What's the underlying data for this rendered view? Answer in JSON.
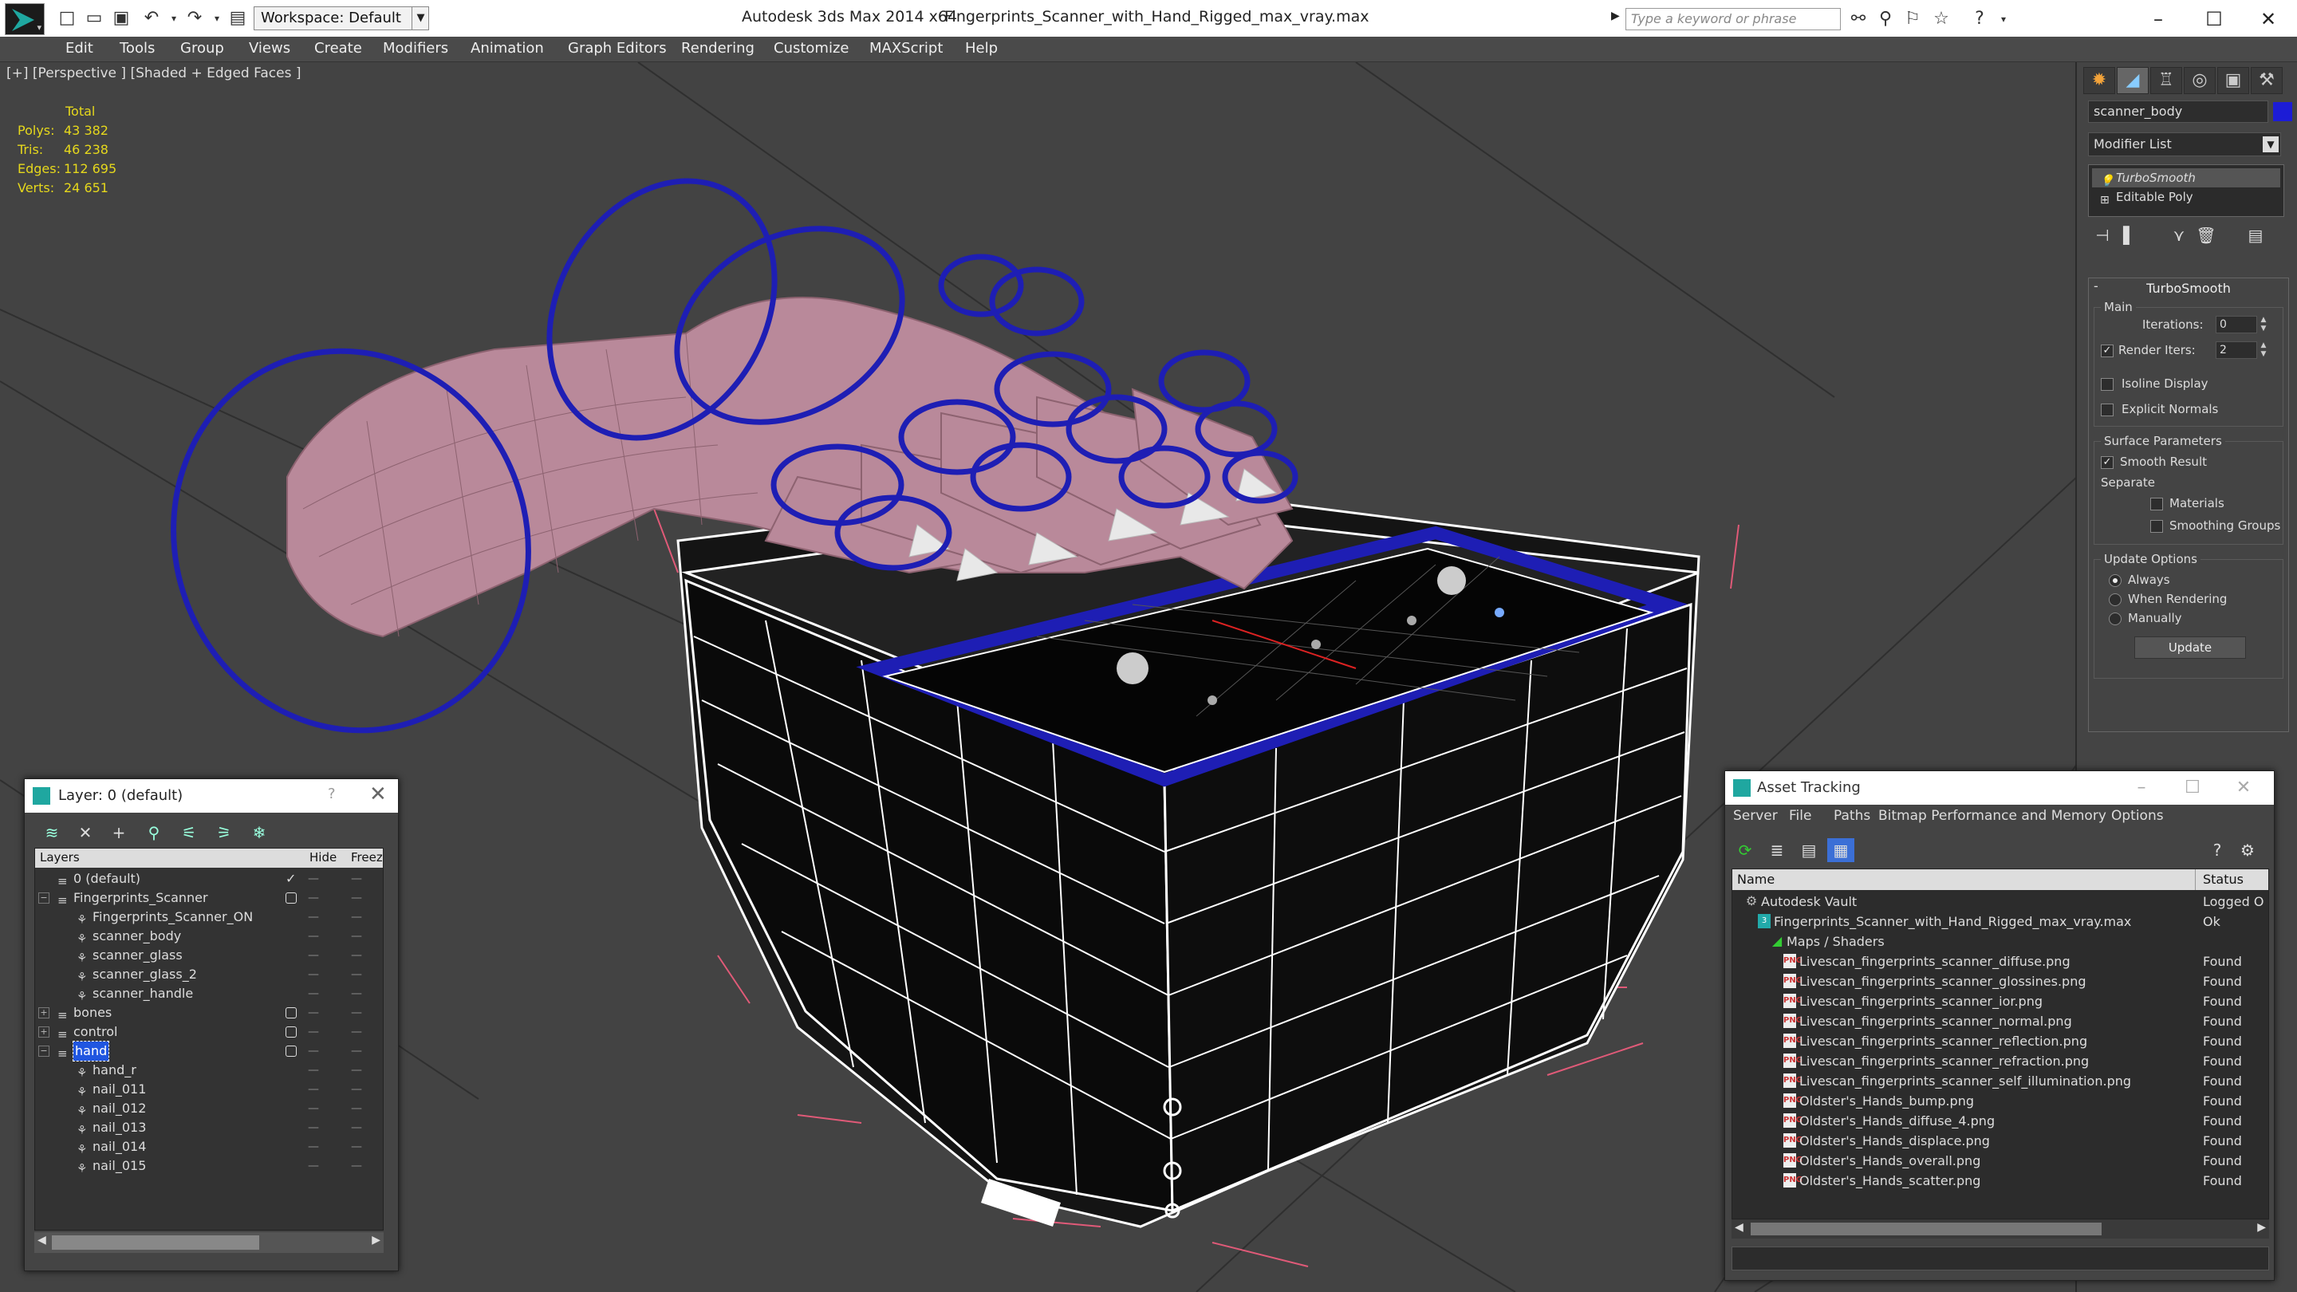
{
  "titlebar": {
    "workspace": "Workspace: Default",
    "app_title": "Autodesk 3ds Max  2014 x64",
    "file_title": "Fingerprints_Scanner_with_Hand_Rigged_max_vray.max",
    "search_placeholder": "Type a keyword or phrase"
  },
  "menus": [
    "Edit",
    "Tools",
    "Group",
    "Views",
    "Create",
    "Modifiers",
    "Animation",
    "Graph Editors",
    "Rendering",
    "Customize",
    "MAXScript",
    "Help"
  ],
  "viewport": {
    "label": "[+] [Perspective ] [Shaded + Edged Faces ]",
    "stats": {
      "header": "Total",
      "rows": [
        {
          "k": "Polys:",
          "v": "43 382"
        },
        {
          "k": "Tris:",
          "v": "46 238"
        },
        {
          "k": "Edges:",
          "v": "112 695"
        },
        {
          "k": "Verts:",
          "v": "24 651"
        }
      ]
    }
  },
  "command_panel": {
    "object_name": "scanner_body",
    "object_color": "#1c1cd6",
    "modifier_list": "Modifier List",
    "stack": [
      "TurboSmooth",
      "Editable Poly"
    ],
    "rollout_title": "TurboSmooth",
    "main_label": "Main",
    "iterations_label": "Iterations:",
    "iterations_value": "0",
    "render_iters_label": "Render Iters:",
    "render_iters_value": "2",
    "isoline": "Isoline Display",
    "explicit": "Explicit Normals",
    "surface_params": "Surface Parameters",
    "smooth_result": "Smooth Result",
    "separate": "Separate",
    "materials": "Materials",
    "smoothing_groups": "Smoothing Groups",
    "update_options": "Update Options",
    "always": "Always",
    "when_rendering": "When Rendering",
    "manually": "Manually",
    "update_button": "Update"
  },
  "layer_dialog": {
    "title": "Layer: 0 (default)",
    "help": "?",
    "col_layers": "Layers",
    "col_hide": "Hide",
    "col_freeze": "Freeze",
    "rows": [
      {
        "name": "0 (default)",
        "indent": 0,
        "type": "layer",
        "state": "current"
      },
      {
        "name": "Fingerprints_Scanner",
        "indent": 0,
        "type": "layer",
        "exp": "−",
        "state": "box"
      },
      {
        "name": "Fingerprints_Scanner_ON",
        "indent": 1,
        "type": "obj"
      },
      {
        "name": "scanner_body",
        "indent": 1,
        "type": "obj"
      },
      {
        "name": "scanner_glass",
        "indent": 1,
        "type": "obj"
      },
      {
        "name": "scanner_glass_2",
        "indent": 1,
        "type": "obj"
      },
      {
        "name": "scanner_handle",
        "indent": 1,
        "type": "obj"
      },
      {
        "name": "bones",
        "indent": 0,
        "type": "layer",
        "exp": "+",
        "state": "box"
      },
      {
        "name": "control",
        "indent": 0,
        "type": "layer",
        "exp": "+",
        "state": "box"
      },
      {
        "name": "hand",
        "indent": 0,
        "type": "layer",
        "exp": "−",
        "state": "box",
        "selected": true
      },
      {
        "name": "hand_r",
        "indent": 1,
        "type": "obj"
      },
      {
        "name": "nail_011",
        "indent": 1,
        "type": "obj"
      },
      {
        "name": "nail_012",
        "indent": 1,
        "type": "obj"
      },
      {
        "name": "nail_013",
        "indent": 1,
        "type": "obj"
      },
      {
        "name": "nail_014",
        "indent": 1,
        "type": "obj"
      },
      {
        "name": "nail_015",
        "indent": 1,
        "type": "obj"
      }
    ]
  },
  "asset_dialog": {
    "title": "Asset Tracking",
    "menus": [
      "Server",
      "File",
      "Paths",
      "Bitmap Performance and Memory",
      "Options"
    ],
    "col_name": "Name",
    "col_status": "Status",
    "rows": [
      {
        "name": "Autodesk Vault",
        "indent": 0,
        "icon": "vault",
        "status": "Logged O"
      },
      {
        "name": "Fingerprints_Scanner_with_Hand_Rigged_max_vray.max",
        "indent": 1,
        "icon": "max",
        "status": "Ok"
      },
      {
        "name": "Maps / Shaders",
        "indent": 2,
        "icon": "fold",
        "status": ""
      },
      {
        "name": "Livescan_fingerprints_scanner_diffuse.png",
        "indent": 3,
        "icon": "png",
        "status": "Found"
      },
      {
        "name": "Livescan_fingerprints_scanner_glossines.png",
        "indent": 3,
        "icon": "png",
        "status": "Found"
      },
      {
        "name": "Livescan_fingerprints_scanner_ior.png",
        "indent": 3,
        "icon": "png",
        "status": "Found"
      },
      {
        "name": "Livescan_fingerprints_scanner_normal.png",
        "indent": 3,
        "icon": "png",
        "status": "Found"
      },
      {
        "name": "Livescan_fingerprints_scanner_reflection.png",
        "indent": 3,
        "icon": "png",
        "status": "Found"
      },
      {
        "name": "Livescan_fingerprints_scanner_refraction.png",
        "indent": 3,
        "icon": "png",
        "status": "Found"
      },
      {
        "name": "Livescan_fingerprints_scanner_self_illumination.png",
        "indent": 3,
        "icon": "png",
        "status": "Found"
      },
      {
        "name": "Oldster's_Hands_bump.png",
        "indent": 3,
        "icon": "png",
        "status": "Found"
      },
      {
        "name": "Oldster's_Hands_diffuse_4.png",
        "indent": 3,
        "icon": "png",
        "status": "Found"
      },
      {
        "name": "Oldster's_Hands_displace.png",
        "indent": 3,
        "icon": "png",
        "status": "Found"
      },
      {
        "name": "Oldster's_Hands_overall.png",
        "indent": 3,
        "icon": "png",
        "status": "Found"
      },
      {
        "name": "Oldster's_Hands_scatter.png",
        "indent": 3,
        "icon": "png",
        "status": "Found"
      }
    ]
  },
  "colors": {
    "viewport_bg": "#434343",
    "stats_text": "#e6d81c",
    "bone_wire": "#1e1eb4",
    "hand_skin": "#b9899a",
    "selection": "#2056e0"
  }
}
